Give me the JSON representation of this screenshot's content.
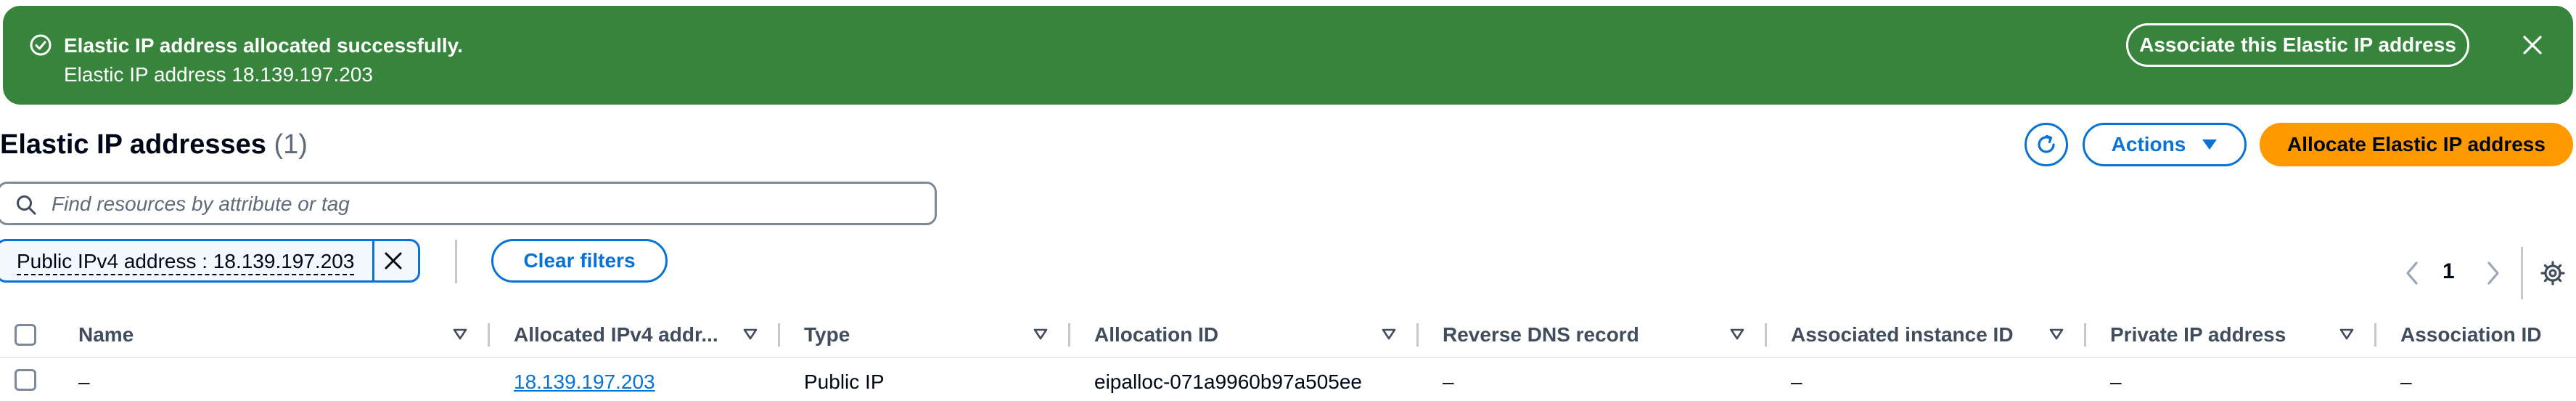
{
  "flash": {
    "title": "Elastic IP address allocated successfully.",
    "message": "Elastic IP address 18.139.197.203",
    "associate_button": "Associate this Elastic IP address",
    "color": "#37843c"
  },
  "header": {
    "title": "Elastic IP addresses",
    "count": "(1)",
    "actions_label": "Actions",
    "allocate_label": "Allocate Elastic IP address",
    "accent_color": "#0972d3",
    "primary_color": "#ff9900"
  },
  "search": {
    "placeholder": "Find resources by attribute or tag",
    "value": ""
  },
  "filter": {
    "token_label": "Public IPv4 address : 18.139.197.203",
    "clear_label": "Clear filters"
  },
  "pagination": {
    "current_page": "1"
  },
  "table": {
    "columns": [
      {
        "label": "Name"
      },
      {
        "label": "Allocated IPv4 addr..."
      },
      {
        "label": "Type"
      },
      {
        "label": "Allocation ID"
      },
      {
        "label": "Reverse DNS record"
      },
      {
        "label": "Associated instance ID"
      },
      {
        "label": "Private IP address"
      },
      {
        "label": "Association ID"
      }
    ],
    "rows": [
      {
        "name": "–",
        "allocated_ipv4": "18.139.197.203",
        "type": "Public IP",
        "allocation_id": "eipalloc-071a9960b97a505ee",
        "reverse_dns": "–",
        "associated_instance_id": "–",
        "private_ip": "–",
        "association_id": "–"
      }
    ]
  },
  "icons": {
    "flash": "success-check-icon",
    "flash_close": "close-icon",
    "refresh": "refresh-icon",
    "actions": "caret-down-icon",
    "search": "search-icon",
    "token_remove": "close-icon",
    "prev": "chevron-left-icon",
    "next": "chevron-right-icon",
    "settings": "gear-icon",
    "sort": "sort-caret-icon"
  }
}
